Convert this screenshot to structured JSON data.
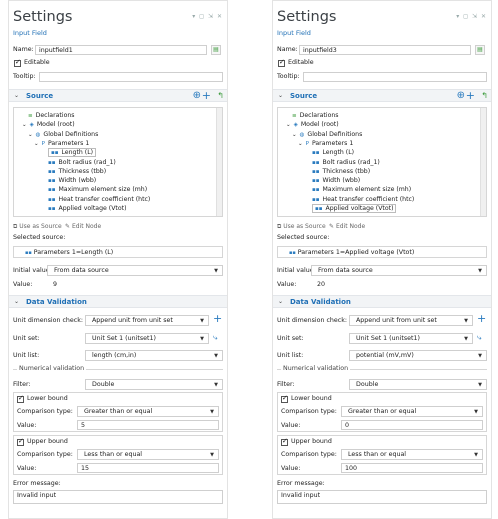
{
  "colors": {
    "accent": "#1f6fb5",
    "header_bg": "#f2f4f6",
    "icon_blue": "#2a7bbf",
    "green": "#3d9b3d"
  },
  "window_controls": "▾ ◻ ⇲ ✕",
  "panels": [
    {
      "title": "Settings",
      "subtitle": "Input Field",
      "name_label": "Name:",
      "name_value": "inputfield1",
      "editable_label": "Editable",
      "tooltip_label": "Tooltip:",
      "source_header": "Source",
      "tree": [
        {
          "label": "Declarations",
          "icon": "declarations-icon"
        },
        {
          "label": "Model (root)",
          "icon": "model-icon"
        },
        {
          "label": "Global Definitions",
          "icon": "globe-icon"
        },
        {
          "label": "Parameters 1",
          "icon": "parameters-icon"
        },
        {
          "label": "Length (L)",
          "icon": "parameter-icon"
        },
        {
          "label": "Bolt radius (rad_1)",
          "icon": "parameter-icon"
        },
        {
          "label": "Thickness (tbb)",
          "icon": "parameter-icon"
        },
        {
          "label": "Width (wbb)",
          "icon": "parameter-icon"
        },
        {
          "label": "Maximum element size (mh)",
          "icon": "parameter-icon"
        },
        {
          "label": "Heat transfer coefficient (htc)",
          "icon": "parameter-icon"
        },
        {
          "label": "Applied voltage (Vtot)",
          "icon": "parameter-icon"
        }
      ],
      "selected_tree_index": 4,
      "use_as_source": "Use as Source",
      "edit_node": "Edit Node",
      "selected_source_label": "Selected source:",
      "selected_source_value": "Parameters 1=Length (L)",
      "initial_value_label": "Initial value:",
      "initial_value": "From data source",
      "value_label": "Value:",
      "value": "9",
      "data_validation_header": "Data Validation",
      "unit_dim_label": "Unit dimension check:",
      "unit_dim_value": "Append unit from unit set",
      "unit_set_label": "Unit set:",
      "unit_set_value": "Unit Set 1 (unitset1)",
      "unit_list_label": "Unit list:",
      "unit_list_value": "length (cm,in)",
      "numerical_validation": "Numerical validation",
      "filter_label": "Filter:",
      "filter_value": "Double",
      "lower_bound_label": "Lower bound",
      "lower_comparison_label": "Comparison type:",
      "lower_comparison_value": "Greater than or equal",
      "lower_value_label": "Value:",
      "lower_value": "5",
      "upper_bound_label": "Upper bound",
      "upper_comparison_label": "Comparison type:",
      "upper_comparison_value": "Less than or equal",
      "upper_value_label": "Value:",
      "upper_value": "15",
      "error_message_label": "Error message:",
      "error_message_value": "Invalid input"
    },
    {
      "title": "Settings",
      "subtitle": "Input Field",
      "name_label": "Name:",
      "name_value": "inputfield3",
      "editable_label": "Editable",
      "tooltip_label": "Tooltip:",
      "source_header": "Source",
      "tree": [
        {
          "label": "Declarations",
          "icon": "declarations-icon"
        },
        {
          "label": "Model (root)",
          "icon": "model-icon"
        },
        {
          "label": "Global Definitions",
          "icon": "globe-icon"
        },
        {
          "label": "Parameters 1",
          "icon": "parameters-icon"
        },
        {
          "label": "Length (L)",
          "icon": "parameter-icon"
        },
        {
          "label": "Bolt radius (rad_1)",
          "icon": "parameter-icon"
        },
        {
          "label": "Thickness (tbb)",
          "icon": "parameter-icon"
        },
        {
          "label": "Width (wbb)",
          "icon": "parameter-icon"
        },
        {
          "label": "Maximum element size (mh)",
          "icon": "parameter-icon"
        },
        {
          "label": "Heat transfer coefficient (htc)",
          "icon": "parameter-icon"
        },
        {
          "label": "Applied voltage (Vtot)",
          "icon": "parameter-icon"
        }
      ],
      "selected_tree_index": 10,
      "use_as_source": "Use as Source",
      "edit_node": "Edit Node",
      "selected_source_label": "Selected source:",
      "selected_source_value": "Parameters 1=Applied voltage (Vtot)",
      "initial_value_label": "Initial value:",
      "initial_value": "From data source",
      "value_label": "Value:",
      "value": "20",
      "data_validation_header": "Data Validation",
      "unit_dim_label": "Unit dimension check:",
      "unit_dim_value": "Append unit from unit set",
      "unit_set_label": "Unit set:",
      "unit_set_value": "Unit Set 1 (unitset1)",
      "unit_list_label": "Unit list:",
      "unit_list_value": "potential (mV,mV)",
      "numerical_validation": "Numerical validation",
      "filter_label": "Filter:",
      "filter_value": "Double",
      "lower_bound_label": "Lower bound",
      "lower_comparison_label": "Comparison type:",
      "lower_comparison_value": "Greater than or equal",
      "lower_value_label": "Value:",
      "lower_value": "0",
      "upper_bound_label": "Upper bound",
      "upper_comparison_label": "Comparison type:",
      "upper_comparison_value": "Less than or equal",
      "upper_value_label": "Value:",
      "upper_value": "100",
      "error_message_label": "Error message:",
      "error_message_value": "Invalid input"
    }
  ]
}
